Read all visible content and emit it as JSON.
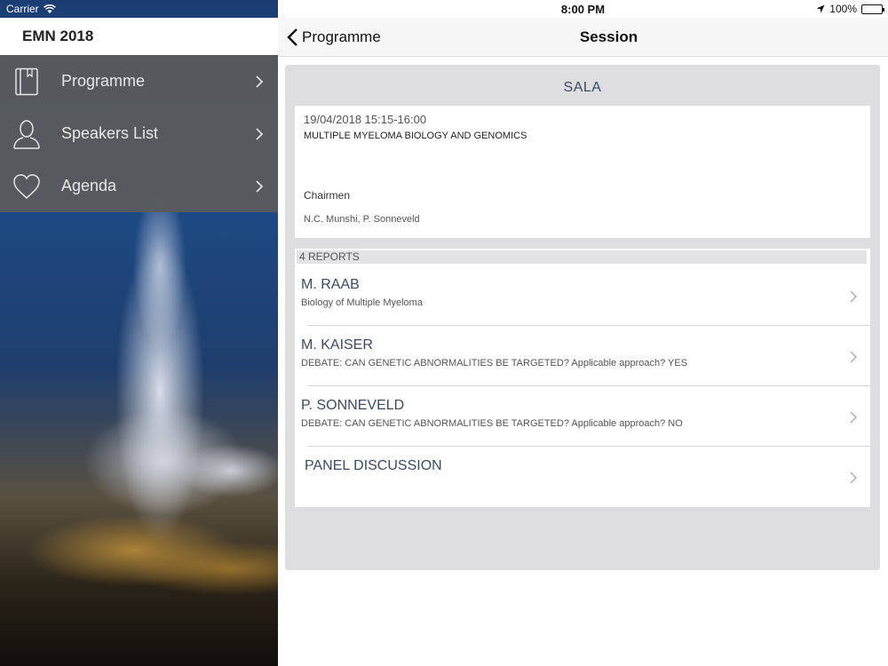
{
  "statusbar": {
    "carrier": "Carrier",
    "time": "8:00 PM",
    "battery": "100%"
  },
  "sidebar": {
    "brand": "EMN 2018",
    "items": [
      {
        "label": "Programme",
        "icon": "book-icon"
      },
      {
        "label": "Speakers List",
        "icon": "person-icon"
      },
      {
        "label": "Agenda",
        "icon": "heart-icon"
      }
    ]
  },
  "navbar": {
    "back_label": "Programme",
    "title": "Session"
  },
  "session": {
    "room": "SALA",
    "datetime": "19/04/2018 15:15-16:00",
    "title": "MULTIPLE MYELOMA BIOLOGY AND GENOMICS",
    "chairmen_label": "Chairmen",
    "chairmen": "N.C. Munshi,  P. Sonneveld"
  },
  "reports": {
    "header": "4 REPORTS",
    "items": [
      {
        "name": "M. RAAB",
        "desc": "Biology of Multiple Myeloma"
      },
      {
        "name": "M. KAISER",
        "desc": "DEBATE: CAN GENETIC ABNORMALITIES BE TARGETED? Applicable approach? YES"
      },
      {
        "name": "P. SONNEVELD",
        "desc": "DEBATE: CAN GENETIC ABNORMALITIES BE TARGETED? Applicable approach? NO"
      },
      {
        "name": "PANEL DISCUSSION",
        "desc": ""
      }
    ]
  },
  "colors": {
    "accent": "#3a4a66",
    "panel_bg": "#dedee0",
    "menu_bg": "#5a5a5a"
  }
}
